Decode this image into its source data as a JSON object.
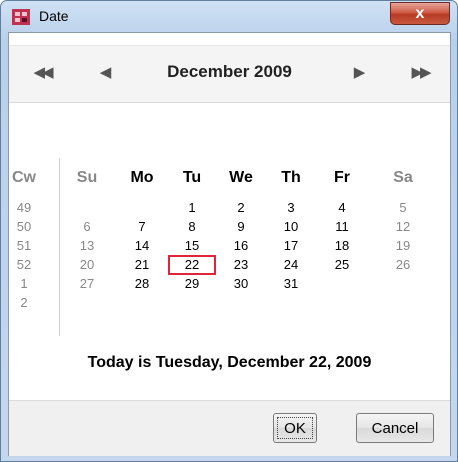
{
  "window": {
    "title": "Date",
    "close_label": "x"
  },
  "nav": {
    "prev_year": "◀◀",
    "prev_month": "◀",
    "month_year": "December 2009",
    "next_month": "▶",
    "next_year": "▶▶"
  },
  "calendar": {
    "headers": [
      "Cw",
      "Su",
      "Mo",
      "Tu",
      "We",
      "Th",
      "Fr",
      "Sa"
    ],
    "weeks": [
      "49",
      "50",
      "51",
      "52",
      "1",
      "2"
    ],
    "rows": [
      [
        "",
        "",
        "1",
        "2",
        "3",
        "4",
        "5"
      ],
      [
        "6",
        "7",
        "8",
        "9",
        "10",
        "11",
        "12"
      ],
      [
        "13",
        "14",
        "15",
        "16",
        "17",
        "18",
        "19"
      ],
      [
        "20",
        "21",
        "22",
        "23",
        "24",
        "25",
        "26"
      ],
      [
        "27",
        "28",
        "29",
        "30",
        "31",
        "",
        ""
      ],
      [
        "",
        "",
        "",
        "",
        "",
        "",
        ""
      ]
    ],
    "selected_day": "22",
    "today_text": "Today is Tuesday, December 22, 2009"
  },
  "buttons": {
    "ok": "OK",
    "cancel": "Cancel"
  },
  "colors": {
    "today_border": "#e0243a",
    "weekend_text": "#888888",
    "weekday_text": "#000000"
  }
}
